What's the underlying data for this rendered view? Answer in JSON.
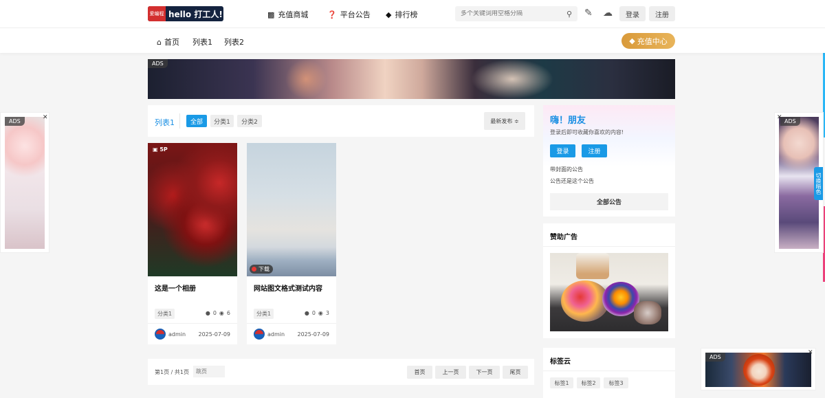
{
  "logo": {
    "badge": "爱编程",
    "text": "hello 打工人!"
  },
  "topnav": [
    {
      "icon": "shop-icon",
      "label": "充值商城"
    },
    {
      "icon": "question-circle-icon",
      "label": "平台公告"
    },
    {
      "icon": "tags-icon",
      "label": "排行榜"
    }
  ],
  "search": {
    "placeholder": "多个关键词用空格分隔"
  },
  "auth": {
    "login": "登录",
    "register": "注册"
  },
  "subnav": {
    "home": "首页",
    "list1": "列表1",
    "list2": "列表2",
    "recharge": "充值中心"
  },
  "ads_label": "ADS",
  "filter": {
    "title": "列表1",
    "chips": [
      "全部",
      "分类1",
      "分类2"
    ],
    "sort": "最新发布 ≑"
  },
  "posts": [
    {
      "badge": "5P",
      "title": "这是一个相册",
      "category": "分类1",
      "comments": "0",
      "views": "6",
      "author": "admin",
      "date": "2025-07-09"
    },
    {
      "badge": "下载",
      "title": "网站图文格式测试内容",
      "category": "分类1",
      "comments": "0",
      "views": "3",
      "author": "admin",
      "date": "2025-07-09"
    }
  ],
  "pagination": {
    "info": "第1页 / 共1页",
    "jump_placeholder": "跳页",
    "first": "首页",
    "prev": "上一页",
    "next": "下一页",
    "last": "尾页"
  },
  "welcome": {
    "hi": "嗨！朋友",
    "sub": "登录后即可收藏你喜欢的内容!",
    "login": "登录",
    "register": "注册",
    "notices": [
      "带封面的公告",
      "公告还是这个公告"
    ],
    "all": "全部公告"
  },
  "sponsor": {
    "title": "赞助广告"
  },
  "tagcloud": {
    "title": "标签云",
    "tags": [
      "标签1",
      "标签2",
      "标签3"
    ]
  },
  "theme_switch": "切换暗色",
  "colors": {
    "accent": "#1a9ae6",
    "gold": "#e0a84a",
    "edge_cyan": "#29b6f6",
    "edge_pink": "#ec407a"
  }
}
